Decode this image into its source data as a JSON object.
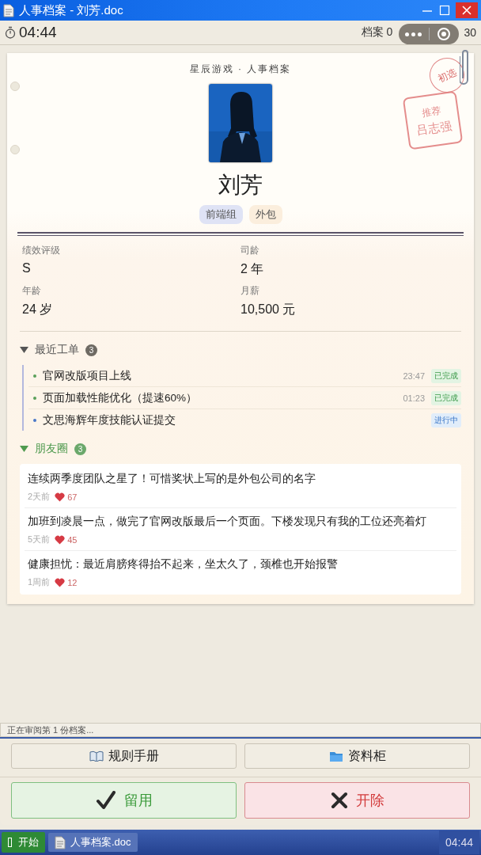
{
  "window": {
    "title": "人事档案 - 刘芳.doc"
  },
  "toolbar": {
    "timer": "04:44",
    "counter_start": "档案 0",
    "counter_end": "30"
  },
  "dossier": {
    "company": "星辰游戏 · 人事档案",
    "seal": "初选",
    "recommendation": {
      "label": "推荐",
      "name": "吕志强"
    },
    "name": "刘芳",
    "tags": [
      {
        "label": "前端组",
        "color": "#dfe3f5"
      },
      {
        "label": "外包",
        "color": "#fbeedd"
      }
    ],
    "stats": [
      {
        "label": "绩效评级",
        "value": "S"
      },
      {
        "label": "司龄",
        "value": "2 年"
      },
      {
        "label": "年龄",
        "value": "24 岁"
      },
      {
        "label": "月薪",
        "value": "10,500 元"
      }
    ],
    "work_orders": {
      "title": "最近工单",
      "count": "3",
      "expanded": true,
      "items": [
        {
          "title": "官网改版项目上线",
          "time": "23:47",
          "status": "已完成",
          "kind": "done"
        },
        {
          "title": "页面加载性能优化（提速60%）",
          "time": "01:23",
          "status": "已完成",
          "kind": "done"
        },
        {
          "title": "文思海辉年度技能认证提交",
          "status": "进行中",
          "kind": "progress"
        }
      ]
    },
    "moments": {
      "title": "朋友圈",
      "count": "3",
      "expanded": true,
      "posts": [
        {
          "text": "连续两季度团队之星了！可惜奖状上写的是外包公司的名字",
          "age": "2天前",
          "likes": "67"
        },
        {
          "text": "加班到凌晨一点，做完了官网改版最后一个页面。下楼发现只有我的工位还亮着灯",
          "age": "5天前",
          "likes": "45"
        },
        {
          "text": "健康担忧：最近肩膀疼得抬不起来，坐太久了，颈椎也开始报警",
          "age": "1周前",
          "likes": "12"
        }
      ]
    }
  },
  "status_bar": "正在审阅第 1 份档案...",
  "tools": [
    {
      "label": "规则手册",
      "kind": "book"
    },
    {
      "label": "资料柜",
      "kind": "folder"
    }
  ],
  "actions": [
    {
      "label": "留用",
      "kind": "keep"
    },
    {
      "label": "开除",
      "kind": "fire"
    }
  ],
  "taskbar": {
    "start": "开始",
    "task": "人事档案.doc",
    "clock": "04:44"
  }
}
